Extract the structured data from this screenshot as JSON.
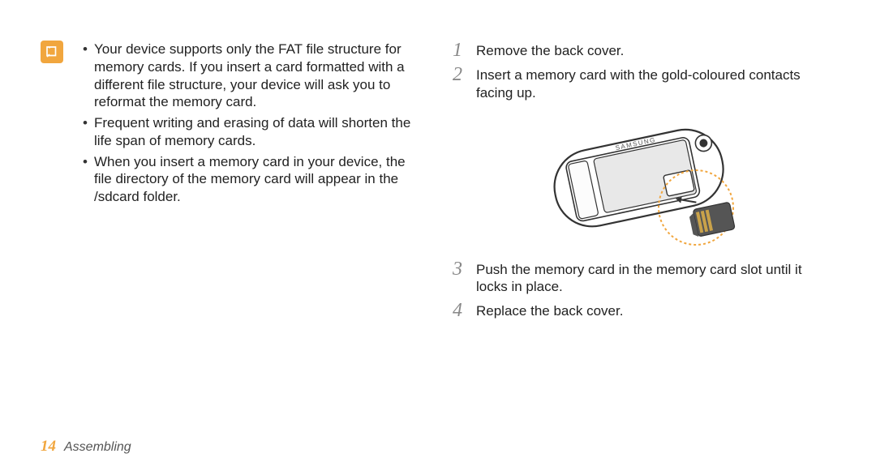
{
  "notes": {
    "bullets": [
      "Your device supports only the FAT file structure for memory cards. If you insert a card formatted with a different file structure, your device will ask you to reformat the memory card.",
      "Frequent writing and erasing of data will shorten the life span of memory cards.",
      "When you insert a memory card in your device, the file directory of the memory card will appear in the /sdcard folder."
    ]
  },
  "steps": {
    "s1": {
      "num": "1",
      "text": "Remove the back cover."
    },
    "s2": {
      "num": "2",
      "text": "Insert a memory card with the gold-coloured contacts facing up."
    },
    "s3": {
      "num": "3",
      "text": "Push the memory card in the memory card slot until it locks in place."
    },
    "s4": {
      "num": "4",
      "text": "Replace the back cover."
    }
  },
  "footer": {
    "page": "14",
    "section": "Assembling"
  },
  "illustration": {
    "brand": "SAMSUNG"
  }
}
